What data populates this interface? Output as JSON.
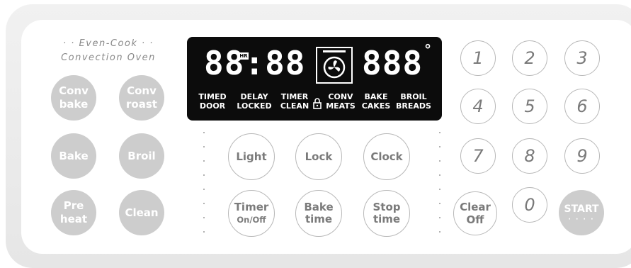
{
  "brand": {
    "line1": "· · Even-Cook · ·",
    "line2": "Convection Oven"
  },
  "display": {
    "time": "88:88",
    "hr_badge": "HR",
    "temp": "888",
    "degree": "°",
    "indicators": [
      {
        "top": "TIMED",
        "bottom": "DOOR"
      },
      {
        "top": "DELAY",
        "bottom": "LOCKED"
      },
      {
        "top": "TIMER",
        "bottom": "CLEAN"
      },
      {
        "top": "CONV",
        "bottom": "MEATS"
      },
      {
        "top": "BAKE",
        "bottom": "CAKES"
      },
      {
        "top": "BROIL",
        "bottom": "BREADS"
      }
    ]
  },
  "left_buttons": {
    "conv_bake": [
      "Conv",
      "bake"
    ],
    "conv_roast": [
      "Conv",
      "roast"
    ],
    "bake": "Bake",
    "broil": "Broil",
    "preheat": [
      "Pre",
      "heat"
    ],
    "clean": "Clean"
  },
  "center_buttons": {
    "light": "Light",
    "lock": "Lock",
    "clock": "Clock",
    "timer": [
      "Timer",
      "On/Off"
    ],
    "bake_time": [
      "Bake",
      "time"
    ],
    "stop_time": [
      "Stop",
      "time"
    ]
  },
  "keypad": {
    "k1": "1",
    "k2": "2",
    "k3": "3",
    "k4": "4",
    "k5": "5",
    "k6": "6",
    "k7": "7",
    "k8": "8",
    "k9": "9",
    "clear_off": [
      "Clear",
      "Off"
    ],
    "k0": "0",
    "start": "START",
    "start_dots": "· · · ·"
  }
}
